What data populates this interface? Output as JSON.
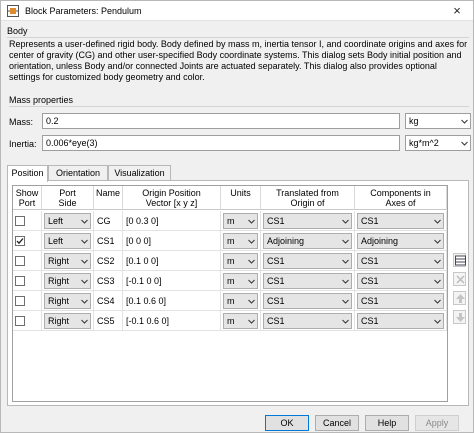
{
  "window": {
    "title": "Block Parameters: Pendulum",
    "close_glyph": "×"
  },
  "block": {
    "type_label": "Body",
    "description": "Represents a user-defined rigid body. Body defined by mass m, inertia tensor I, and coordinate origins and axes for center of gravity (CG) and other user-specified Body coordinate systems. This dialog sets Body initial position and orientation, unless Body and/or connected Joints are actuated separately. This dialog also provides optional settings for customized body geometry and color."
  },
  "mass_properties": {
    "section_label": "Mass properties",
    "mass": {
      "label": "Mass:",
      "value": "0.2",
      "unit": "kg"
    },
    "inertia": {
      "label": "Inertia:",
      "value": "0.006*eye(3)",
      "unit": "kg*m^2"
    }
  },
  "tabs": [
    "Position",
    "Orientation",
    "Visualization"
  ],
  "active_tab": "Position",
  "table": {
    "headers": [
      "Show\nPort",
      "Port\nSide",
      "Name",
      "Origin Position\nVector [x y z]",
      "Units",
      "Translated from\nOrigin of",
      "Components in\nAxes of"
    ],
    "rows": [
      {
        "show_port": false,
        "side": "Left",
        "name": "CG",
        "origin": "[0 0.3 0]",
        "units": "m",
        "translated": "CS1",
        "axes": "CS1"
      },
      {
        "show_port": true,
        "side": "Left",
        "name": "CS1",
        "origin": "[0 0 0]",
        "units": "m",
        "translated": "Adjoining",
        "axes": "Adjoining"
      },
      {
        "show_port": false,
        "side": "Right",
        "name": "CS2",
        "origin": "[0.1 0 0]",
        "units": "m",
        "translated": "CS1",
        "axes": "CS1"
      },
      {
        "show_port": false,
        "side": "Right",
        "name": "CS3",
        "origin": "[-0.1 0 0]",
        "units": "m",
        "translated": "CS1",
        "axes": "CS1"
      },
      {
        "show_port": false,
        "side": "Right",
        "name": "CS4",
        "origin": "[0.1 0.6 0]",
        "units": "m",
        "translated": "CS1",
        "axes": "CS1"
      },
      {
        "show_port": false,
        "side": "Right",
        "name": "CS5",
        "origin": "[-0.1 0.6 0]",
        "units": "m",
        "translated": "CS1",
        "axes": "CS1"
      }
    ]
  },
  "side_buttons": [
    "add-row-icon",
    "delete-row-icon",
    "move-up-icon",
    "move-down-icon"
  ],
  "buttons": {
    "ok": "OK",
    "cancel": "Cancel",
    "help": "Help",
    "apply": "Apply"
  },
  "colors": {
    "accent": "#0078d7",
    "check": "#1a1a1a"
  }
}
